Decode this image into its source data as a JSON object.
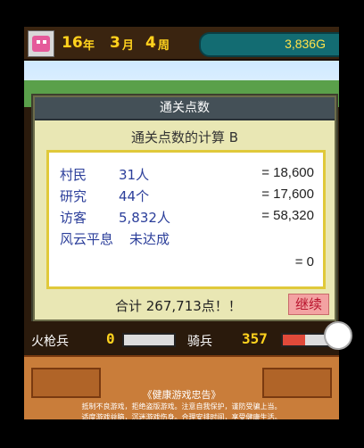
{
  "topbar": {
    "year": "16",
    "year_unit": "年",
    "month": "3",
    "month_unit": "月",
    "week": "4",
    "week_unit": "周",
    "gold": "3,836G"
  },
  "dialog": {
    "title": "通关点数",
    "subtitle": "通关点数的计算 B",
    "rows": [
      {
        "label": "村民",
        "value": "31人",
        "points": "= 18,600"
      },
      {
        "label": "研究",
        "value": "44个",
        "points": "= 17,600"
      },
      {
        "label": "访客",
        "value": "5,832人",
        "points": "= 58,320"
      },
      {
        "label": "风云平息",
        "value": "未达成",
        "points": "= 0"
      }
    ],
    "total": "合计 267,713点！！",
    "continue_label": "继续"
  },
  "units": {
    "row1": {
      "name": "火枪兵",
      "num": "0",
      "fill": 0
    },
    "row2": {
      "name": "骑兵",
      "num": "357",
      "fill": 0.45
    }
  },
  "bottom": {
    "title": "《健康游戏忠告》",
    "line1": "抵制不良游戏，拒绝盗版游戏。注意自我保护，谨防受骗上当。",
    "line2": "适度游戏益脑，沉迷游戏伤身。合理安排时间，享受健康生活。"
  },
  "colors": {
    "accent_gold": "#ffd21e",
    "dialog_bg": "#e9e7b4",
    "continue_bg": "#f3a2a2"
  }
}
